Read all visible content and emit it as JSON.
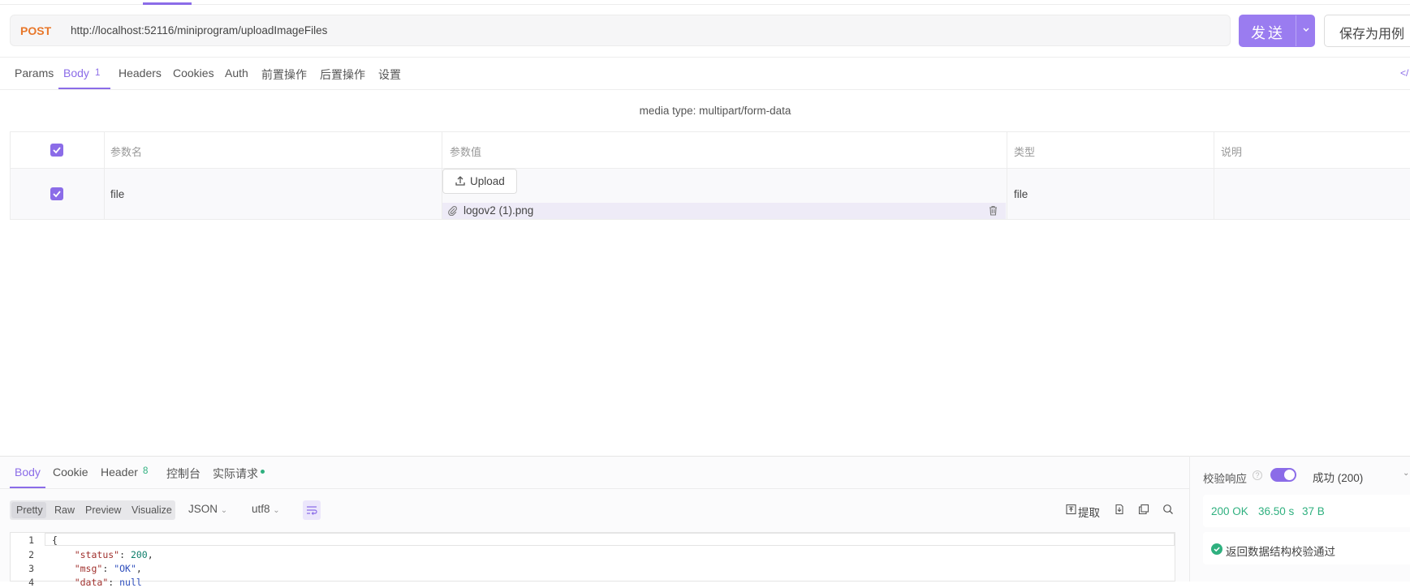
{
  "request": {
    "method": "POST",
    "url": "http://localhost:52116/miniprogram/uploadImageFiles",
    "send_label": "发送",
    "save_label": "保存为用例"
  },
  "request_tabs": {
    "params": "Params",
    "body": "Body",
    "body_count": "1",
    "headers": "Headers",
    "cookies": "Cookies",
    "auth": "Auth",
    "pre": "前置操作",
    "post": "后置操作",
    "settings": "设置",
    "code": "</"
  },
  "body": {
    "media_type": "media type: multipart/form-data",
    "columns": {
      "name": "参数名",
      "value": "参数值",
      "type": "类型",
      "desc": "说明"
    },
    "rows": [
      {
        "name": "file",
        "upload_label": "Upload",
        "file_name": "logov2 (1).png",
        "type": "file",
        "desc": ""
      }
    ]
  },
  "response_tabs": {
    "body": "Body",
    "cookie": "Cookie",
    "header": "Header",
    "header_count": "8",
    "console": "控制台",
    "actual": "实际请求"
  },
  "viewer": {
    "formats": [
      "Pretty",
      "Raw",
      "Preview",
      "Visualize"
    ],
    "language": "JSON",
    "encoding": "utf8",
    "extract_label": "提取"
  },
  "code": {
    "line_numbers": [
      "1",
      "2",
      "3",
      "4"
    ],
    "line1": "{",
    "status_key": "\"status\"",
    "status_val": "200",
    "msg_key": "\"msg\"",
    "msg_val": "\"OK\"",
    "data_key": "\"data\"",
    "data_val": "null"
  },
  "validation": {
    "label": "校验响应",
    "enabled": true,
    "result_select": "成功 (200)",
    "status_code": "200 OK",
    "time": "36.50 s",
    "size": "37 B",
    "message": "返回数据结构校验通过"
  },
  "colors": {
    "accent": "#8b6ce8",
    "method": "#e8772a",
    "success": "#2fb07f"
  }
}
